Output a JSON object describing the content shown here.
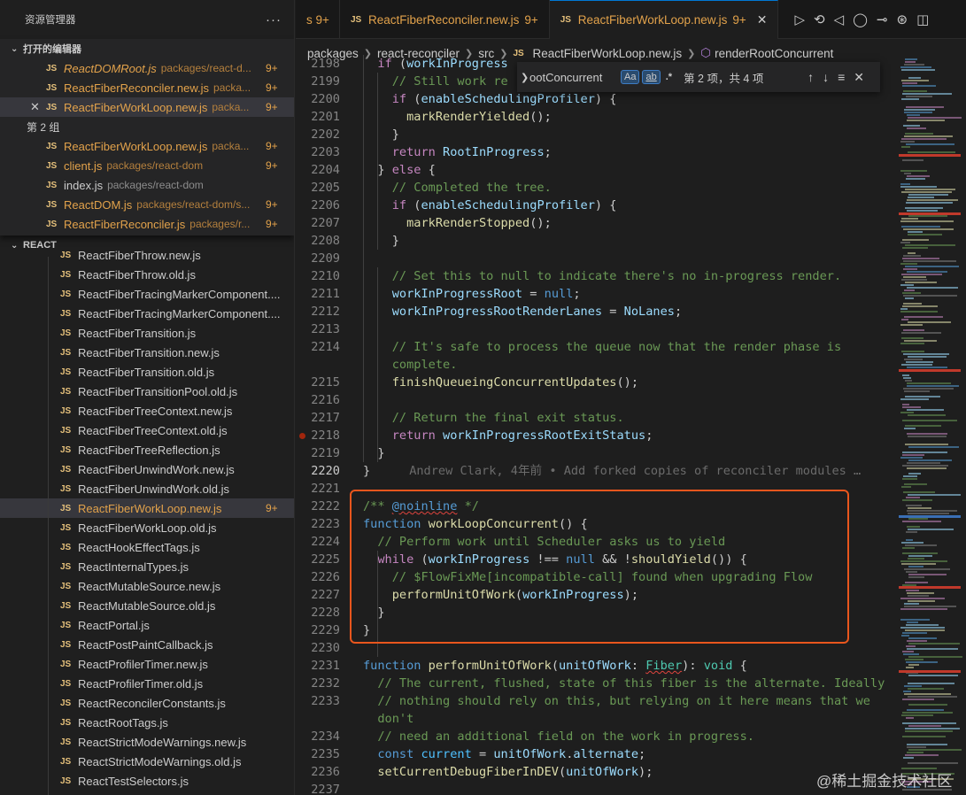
{
  "sidebar": {
    "title": "资源管理器",
    "more": "···",
    "open_editors_label": "打开的编辑器",
    "open_editors": [
      {
        "name": "ReactDOMRoot.js",
        "path": "packages/react-d...",
        "badge": "9+",
        "italic": true
      },
      {
        "name": "ReactFiberReconciler.new.js",
        "path": "packa...",
        "badge": "9+"
      },
      {
        "name": "ReactFiberWorkLoop.new.js",
        "path": "packa...",
        "badge": "9+",
        "active": true
      }
    ],
    "group2_label": "第 2 组",
    "group2": [
      {
        "name": "ReactFiberWorkLoop.new.js",
        "path": "packa...",
        "badge": "9+"
      },
      {
        "name": "client.js",
        "path": "packages/react-dom",
        "badge": "9+"
      },
      {
        "name": "index.js",
        "path": "packages/react-dom",
        "badge": ""
      },
      {
        "name": "ReactDOM.js",
        "path": "packages/react-dom/s...",
        "badge": "9+"
      },
      {
        "name": "ReactFiberReconciler.js",
        "path": "packages/r...",
        "badge": "9+"
      }
    ],
    "react_label": "REACT",
    "tree": [
      {
        "name": "ReactFiberThrow.new.js",
        "mod": false
      },
      {
        "name": "ReactFiberThrow.old.js",
        "mod": false
      },
      {
        "name": "ReactFiberTracingMarkerComponent....",
        "mod": false
      },
      {
        "name": "ReactFiberTracingMarkerComponent....",
        "mod": false
      },
      {
        "name": "ReactFiberTransition.js",
        "mod": false
      },
      {
        "name": "ReactFiberTransition.new.js",
        "mod": false
      },
      {
        "name": "ReactFiberTransition.old.js",
        "mod": false
      },
      {
        "name": "ReactFiberTransitionPool.old.js",
        "mod": false
      },
      {
        "name": "ReactFiberTreeContext.new.js",
        "mod": false
      },
      {
        "name": "ReactFiberTreeContext.old.js",
        "mod": false
      },
      {
        "name": "ReactFiberTreeReflection.js",
        "mod": false
      },
      {
        "name": "ReactFiberUnwindWork.new.js",
        "mod": false
      },
      {
        "name": "ReactFiberUnwindWork.old.js",
        "mod": false
      },
      {
        "name": "ReactFiberWorkLoop.new.js",
        "mod": true,
        "badge": "9+",
        "selected": true
      },
      {
        "name": "ReactFiberWorkLoop.old.js",
        "mod": false
      },
      {
        "name": "ReactHookEffectTags.js",
        "mod": false
      },
      {
        "name": "ReactInternalTypes.js",
        "mod": false
      },
      {
        "name": "ReactMutableSource.new.js",
        "mod": false
      },
      {
        "name": "ReactMutableSource.old.js",
        "mod": false
      },
      {
        "name": "ReactPortal.js",
        "mod": false
      },
      {
        "name": "ReactPostPaintCallback.js",
        "mod": false
      },
      {
        "name": "ReactProfilerTimer.new.js",
        "mod": false
      },
      {
        "name": "ReactProfilerTimer.old.js",
        "mod": false
      },
      {
        "name": "ReactReconcilerConstants.js",
        "mod": false
      },
      {
        "name": "ReactRootTags.js",
        "mod": false
      },
      {
        "name": "ReactStrictModeWarnings.new.js",
        "mod": false
      },
      {
        "name": "ReactStrictModeWarnings.old.js",
        "mod": false
      },
      {
        "name": "ReactTestSelectors.js",
        "mod": false
      }
    ]
  },
  "tabs": [
    {
      "name": "",
      "badge": "s 9+",
      "partial": true
    },
    {
      "name": "ReactFiberReconciler.new.js",
      "badge": "9+"
    },
    {
      "name": "ReactFiberWorkLoop.new.js",
      "badge": "9+",
      "active": true
    }
  ],
  "breadcrumb": [
    "packages",
    "react-reconciler",
    "src",
    "ReactFiberWorkLoop.new.js",
    "renderRootConcurrent"
  ],
  "find": {
    "value": "ootConcurrent",
    "opt_case": "Aa",
    "opt_word": "ab",
    "opt_regex": ".*",
    "result": "第 2 项，共 4 项"
  },
  "code": {
    "lines": [
      {
        "n": "2198",
        "html": "  <span class='kc'>if</span> (<span class='var'>workInProgress</span>"
      },
      {
        "n": "2199",
        "html": "    <span class='cm'>// Still work re</span>"
      },
      {
        "n": "2200",
        "html": "    <span class='kc'>if</span> (<span class='var'>enableSchedulingProfiler</span>) {"
      },
      {
        "n": "2201",
        "html": "      <span class='fn'>markRenderYielded</span>();"
      },
      {
        "n": "2202",
        "html": "    }"
      },
      {
        "n": "2203",
        "html": "    <span class='kc'>return</span> <span class='var'>RootInProgress</span>;"
      },
      {
        "n": "2204",
        "html": "  } <span class='kc'>else</span> {"
      },
      {
        "n": "2205",
        "html": "    <span class='cm'>// Completed the tree.</span>"
      },
      {
        "n": "2206",
        "html": "    <span class='kc'>if</span> (<span class='var'>enableSchedulingProfiler</span>) {"
      },
      {
        "n": "2207",
        "html": "      <span class='fn'>markRenderStopped</span>();"
      },
      {
        "n": "2208",
        "html": "    }"
      },
      {
        "n": "2209",
        "html": ""
      },
      {
        "n": "2210",
        "html": "    <span class='cm'>// Set this to null to indicate there's no in-progress render.</span>"
      },
      {
        "n": "2211",
        "html": "    <span class='var'>workInProgressRoot</span> = <span class='kw'>null</span>;"
      },
      {
        "n": "2212",
        "html": "    <span class='var'>workInProgressRootRenderLanes</span> = <span class='var'>NoLanes</span>;"
      },
      {
        "n": "2213",
        "html": ""
      },
      {
        "n": "2214",
        "html": "    <span class='cm'>// It's safe to process the queue now that the render phase is</span>"
      },
      {
        "n": "",
        "html": "    <span class='cm'>complete.</span>"
      },
      {
        "n": "2215",
        "html": "    <span class='fn'>finishQueueingConcurrentUpdates</span>();"
      },
      {
        "n": "2216",
        "html": ""
      },
      {
        "n": "2217",
        "html": "    <span class='cm'>// Return the final exit status.</span>"
      },
      {
        "n": "2218",
        "html": "    <span class='kc'>return</span> <span class='var'>workInProgressRootExitStatus</span>;",
        "bp": true
      },
      {
        "n": "2219",
        "html": "  }"
      },
      {
        "n": "2220",
        "html": "}<span class='blame'>Andrew Clark, 4年前 • Add forked copies of reconciler modules …</span>",
        "cur": true
      },
      {
        "n": "2221",
        "html": ""
      },
      {
        "n": "2222",
        "html": "<span class='cm'>/** </span><span class='kw wavy'>@noinline</span><span class='cm'> */</span>"
      },
      {
        "n": "2223",
        "html": "<span class='kw'>function</span> <span class='fn'>workLoopConcurrent</span>() {"
      },
      {
        "n": "2224",
        "html": "  <span class='cm'>// Perform work until Scheduler asks us to yield</span>"
      },
      {
        "n": "2225",
        "html": "  <span class='kc'>while</span> (<span class='var'>workInProgress</span> !== <span class='kw'>null</span> &amp;&amp; !<span class='fn'>shouldYield</span>()) {"
      },
      {
        "n": "2226",
        "html": "    <span class='cm'>// $FlowFixMe[incompatible-call] found when upgrading Flow</span>"
      },
      {
        "n": "2227",
        "html": "    <span class='fn'>performUnitOfWork</span>(<span class='var'>workInProgress</span>);"
      },
      {
        "n": "2228",
        "html": "  }"
      },
      {
        "n": "2229",
        "html": "}"
      },
      {
        "n": "2230",
        "html": ""
      },
      {
        "n": "2231",
        "html": "<span class='kw'>function</span> <span class='fn'>performUnitOfWork</span>(<span class='var'>unitOfWork</span>: <span class='ty wavy'>Fiber</span>): <span class='ty'>void</span> {"
      },
      {
        "n": "2232",
        "html": "  <span class='cm'>// The current, flushed, state of this fiber is the alternate. Ideally</span>"
      },
      {
        "n": "2233",
        "html": "  <span class='cm'>// nothing should rely on this, but relying on it here means that we</span>"
      },
      {
        "n": "",
        "html": "  <span class='cm'>don't</span>"
      },
      {
        "n": "2234",
        "html": "  <span class='cm'>// need an additional field on the work in progress.</span>"
      },
      {
        "n": "2235",
        "html": "  <span class='kw'>const</span> <span class='const'>current</span> = <span class='var'>unitOfWork</span>.<span class='var'>alternate</span>;"
      },
      {
        "n": "2236",
        "html": "  <span class='fn'>setCurrentDebugFiberInDEV</span>(<span class='var'>unitOfWork</span>);"
      },
      {
        "n": "2237",
        "html": ""
      }
    ]
  },
  "watermark": "@稀土掘金技术社区",
  "colors": {
    "accent": "#0078d4",
    "modified": "#e2a24b",
    "highlight_border": "#e9561d"
  }
}
